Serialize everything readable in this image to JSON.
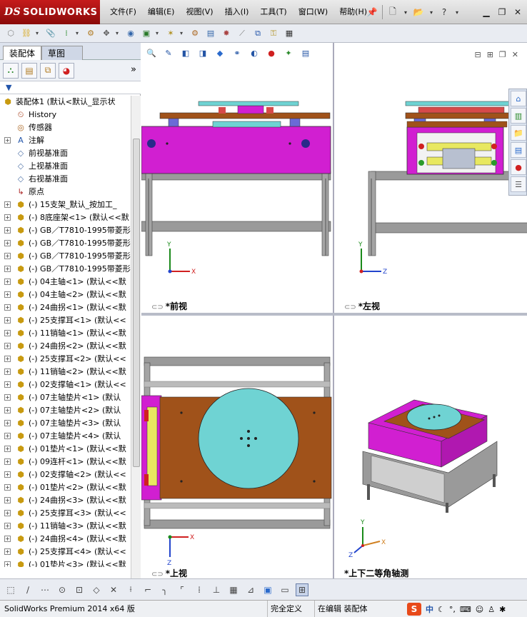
{
  "app": {
    "logo_text": "SOLIDWORKS",
    "logo_prefix": "DS"
  },
  "menu": {
    "items": [
      "文件(F)",
      "编辑(E)",
      "视图(V)",
      "插入(I)",
      "工具(T)",
      "窗口(W)",
      "帮助(H)"
    ]
  },
  "panel": {
    "tab_assembly": "装配体",
    "tab_sketch": "草图",
    "more": "»"
  },
  "tree": {
    "root": "装配体1  (默认<默认_显示状",
    "items": [
      {
        "label": "History",
        "icon": "history-icon",
        "expand": false
      },
      {
        "label": "传感器",
        "icon": "sensor-icon",
        "expand": false
      },
      {
        "label": "注解",
        "icon": "annotation-icon",
        "expand": true
      },
      {
        "label": "前视基准面",
        "icon": "plane-icon",
        "expand": false
      },
      {
        "label": "上视基准面",
        "icon": "plane-icon",
        "expand": false
      },
      {
        "label": "右视基准面",
        "icon": "plane-icon",
        "expand": false
      },
      {
        "label": "原点",
        "icon": "origin-icon",
        "expand": false
      },
      {
        "label": "(-) 15支架_默认_按加工_",
        "icon": "part-icon",
        "expand": true
      },
      {
        "label": "(-) 8底座架<1> (默认<<默",
        "icon": "part-icon",
        "expand": true
      },
      {
        "label": "(-) GB／T7810-1995带菱形",
        "icon": "part-icon",
        "expand": true
      },
      {
        "label": "(-) GB／T7810-1995带菱形",
        "icon": "part-icon",
        "expand": true
      },
      {
        "label": "(-) GB／T7810-1995带菱形",
        "icon": "part-icon",
        "expand": true
      },
      {
        "label": "(-) GB／T7810-1995带菱形",
        "icon": "part-icon",
        "expand": true
      },
      {
        "label": "(-) 04主轴<1> (默认<<默",
        "icon": "part-icon",
        "expand": true
      },
      {
        "label": "(-) 04主轴<2> (默认<<默",
        "icon": "part-icon",
        "expand": true
      },
      {
        "label": "(-) 24曲拐<1> (默认<<默",
        "icon": "part-icon",
        "expand": true
      },
      {
        "label": "(-) 25支撑耳<1> (默认<<",
        "icon": "part-icon",
        "expand": true
      },
      {
        "label": "(-) 11销轴<1> (默认<<默",
        "icon": "part-icon",
        "expand": true
      },
      {
        "label": "(-) 24曲拐<2> (默认<<默",
        "icon": "part-icon",
        "expand": true
      },
      {
        "label": "(-) 25支撑耳<2> (默认<<",
        "icon": "part-icon",
        "expand": true
      },
      {
        "label": "(-) 11销轴<2> (默认<<默",
        "icon": "part-icon",
        "expand": true
      },
      {
        "label": "(-) 02支撑轴<1> (默认<<",
        "icon": "part-icon",
        "expand": true
      },
      {
        "label": "(-) 07主轴垫片<1> (默认",
        "icon": "part-icon",
        "expand": true
      },
      {
        "label": "(-) 07主轴垫片<2> (默认",
        "icon": "part-icon",
        "expand": true
      },
      {
        "label": "(-) 07主轴垫片<3> (默认",
        "icon": "part-icon",
        "expand": true
      },
      {
        "label": "(-) 07主轴垫片<4> (默认",
        "icon": "part-icon",
        "expand": true
      },
      {
        "label": "(-) 01垫片<1> (默认<<默",
        "icon": "part-icon",
        "expand": true
      },
      {
        "label": "(-) 09连杆<1> (默认<<默",
        "icon": "part-icon",
        "expand": true
      },
      {
        "label": "(-) 02支撑轴<2> (默认<<",
        "icon": "part-icon",
        "expand": true
      },
      {
        "label": "(-) 01垫片<2> (默认<<默",
        "icon": "part-icon",
        "expand": true
      },
      {
        "label": "(-) 24曲拐<3> (默认<<默",
        "icon": "part-icon",
        "expand": true
      },
      {
        "label": "(-) 25支撑耳<3> (默认<<",
        "icon": "part-icon",
        "expand": true
      },
      {
        "label": "(-) 11销轴<3> (默认<<默",
        "icon": "part-icon",
        "expand": true
      },
      {
        "label": "(-) 24曲拐<4> (默认<<默",
        "icon": "part-icon",
        "expand": true
      },
      {
        "label": "(-) 25支撑耳<4> (默认<<",
        "icon": "part-icon",
        "expand": true
      },
      {
        "label": "(-) 01垫片<3> (默认<<默",
        "icon": "part-icon",
        "expand": true
      }
    ]
  },
  "viewports": {
    "front": "*前视",
    "left": "*左视",
    "top": "*上视",
    "iso": "*上下二等角轴测"
  },
  "axes": {
    "x": "X",
    "y": "Y",
    "z": "Z"
  },
  "status": {
    "product": "SolidWorks Premium 2014 x64 版",
    "definition": "完全定义",
    "editing": "在编辑 装配体",
    "ime_label": "中"
  },
  "colors": {
    "magenta": "#d11fd1",
    "wood": "#a0521a",
    "cyan": "#6fd3d3",
    "frame": "#8c8c8c",
    "accent_red": "#c51b1b"
  }
}
